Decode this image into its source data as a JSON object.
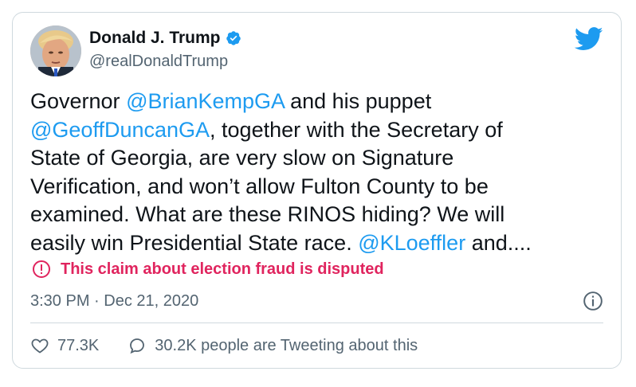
{
  "tweet": {
    "author": {
      "name": "Donald J. Trump",
      "handle": "@realDonaldTrump",
      "verified": true
    },
    "text_segments": [
      {
        "text": "Governor ",
        "type": "text"
      },
      {
        "text": "@BrianKempGA",
        "type": "mention"
      },
      {
        "text": " and his puppet\n",
        "type": "text"
      },
      {
        "text": "@GeoffDuncanGA",
        "type": "mention"
      },
      {
        "text": ", together with the Secretary of\nState of Georgia, are very slow on Signature\nVerification, and won’t allow Fulton County to be\nexamined. What are these RINOS hiding? We will\neasily win Presidential State race. ",
        "type": "text"
      },
      {
        "text": "@KLoeffler",
        "type": "mention"
      },
      {
        "text": " and....",
        "type": "text"
      }
    ],
    "warning": "This claim about election fraud is disputed",
    "timestamp": "3:30 PM · Dec 21, 2020",
    "likes": "77.3K",
    "tweeting": "30.2K people are Tweeting about this"
  },
  "colors": {
    "mention": "#1d9bf0",
    "warning": "#e0245e",
    "secondary_text": "#536471",
    "twitter_blue": "#1d9bf0"
  },
  "icons": [
    "twitter-bird-icon",
    "verified-badge-icon",
    "warning-circle-icon",
    "info-icon",
    "heart-icon",
    "comment-bubble-icon"
  ]
}
